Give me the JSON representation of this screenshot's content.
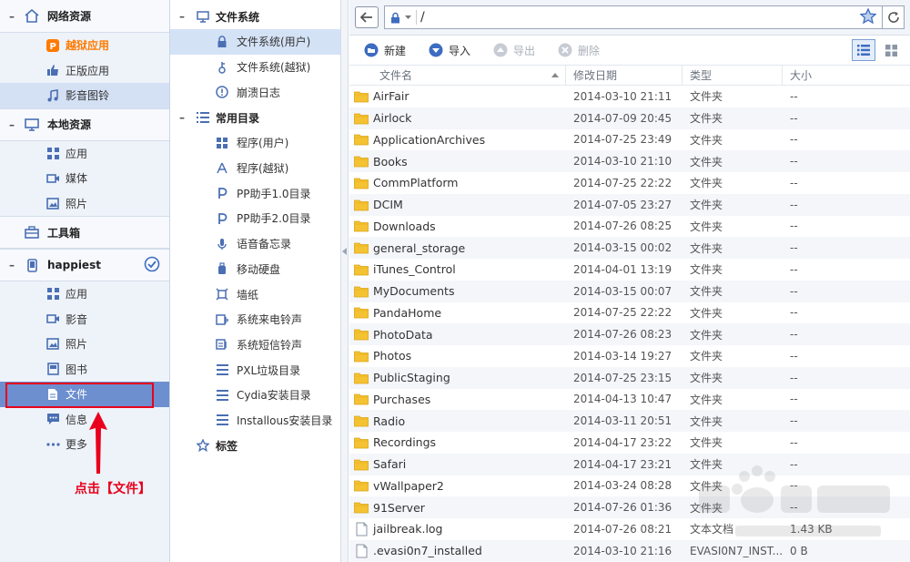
{
  "left": {
    "sections": [
      {
        "id": "network",
        "title": "网络资源",
        "items": [
          "越狱应用",
          "正版应用",
          "影音图铃"
        ]
      },
      {
        "id": "local",
        "title": "本地资源",
        "items": [
          "应用",
          "媒体",
          "照片"
        ]
      },
      {
        "id": "tools",
        "title": "工具箱"
      },
      {
        "id": "device",
        "title": "happiest",
        "items": [
          "应用",
          "影音",
          "照片",
          "图书",
          "文件",
          "信息",
          "更多"
        ]
      }
    ],
    "annotation": "点击【文件】"
  },
  "tree": {
    "fs_title": "文件系统",
    "fs_items": [
      "文件系统(用户)",
      "文件系统(越狱)",
      "崩溃日志"
    ],
    "common_title": "常用目录",
    "common_items": [
      "程序(用户)",
      "程序(越狱)",
      "PP助手1.0目录",
      "PP助手2.0目录",
      "语音备忘录",
      "移动硬盘",
      "墙纸",
      "系统来电铃声",
      "系统短信铃声",
      "PXL垃圾目录",
      "Cydia安装目录",
      "Installous安装目录"
    ],
    "tags_title": "标签"
  },
  "address": {
    "path": "/"
  },
  "toolbar": {
    "new": "新建",
    "import": "导入",
    "export": "导出",
    "delete": "删除"
  },
  "columns": {
    "name": "文件名",
    "date": "修改日期",
    "type": "类型",
    "size": "大小"
  },
  "files": [
    {
      "name": "AirFair",
      "date": "2014-03-10 21:11",
      "type": "文件夹",
      "size": "--",
      "kind": "folder"
    },
    {
      "name": "Airlock",
      "date": "2014-07-09 20:45",
      "type": "文件夹",
      "size": "--",
      "kind": "folder"
    },
    {
      "name": "ApplicationArchives",
      "date": "2014-07-25 23:49",
      "type": "文件夹",
      "size": "--",
      "kind": "folder"
    },
    {
      "name": "Books",
      "date": "2014-03-10 21:10",
      "type": "文件夹",
      "size": "--",
      "kind": "folder"
    },
    {
      "name": "CommPlatform",
      "date": "2014-07-25 22:22",
      "type": "文件夹",
      "size": "--",
      "kind": "folder"
    },
    {
      "name": "DCIM",
      "date": "2014-07-05 23:27",
      "type": "文件夹",
      "size": "--",
      "kind": "folder"
    },
    {
      "name": "Downloads",
      "date": "2014-07-26 08:25",
      "type": "文件夹",
      "size": "--",
      "kind": "folder"
    },
    {
      "name": "general_storage",
      "date": "2014-03-15 00:02",
      "type": "文件夹",
      "size": "--",
      "kind": "folder"
    },
    {
      "name": "iTunes_Control",
      "date": "2014-04-01 13:19",
      "type": "文件夹",
      "size": "--",
      "kind": "folder"
    },
    {
      "name": "MyDocuments",
      "date": "2014-03-15 00:07",
      "type": "文件夹",
      "size": "--",
      "kind": "folder"
    },
    {
      "name": "PandaHome",
      "date": "2014-07-25 22:22",
      "type": "文件夹",
      "size": "--",
      "kind": "folder"
    },
    {
      "name": "PhotoData",
      "date": "2014-07-26 08:23",
      "type": "文件夹",
      "size": "--",
      "kind": "folder"
    },
    {
      "name": "Photos",
      "date": "2014-03-14 19:27",
      "type": "文件夹",
      "size": "--",
      "kind": "folder"
    },
    {
      "name": "PublicStaging",
      "date": "2014-07-25 23:15",
      "type": "文件夹",
      "size": "--",
      "kind": "folder"
    },
    {
      "name": "Purchases",
      "date": "2014-04-13 10:47",
      "type": "文件夹",
      "size": "--",
      "kind": "folder"
    },
    {
      "name": "Radio",
      "date": "2014-03-11 20:51",
      "type": "文件夹",
      "size": "--",
      "kind": "folder"
    },
    {
      "name": "Recordings",
      "date": "2014-04-17 23:22",
      "type": "文件夹",
      "size": "--",
      "kind": "folder"
    },
    {
      "name": "Safari",
      "date": "2014-04-17 23:21",
      "type": "文件夹",
      "size": "--",
      "kind": "folder"
    },
    {
      "name": "vWallpaper2",
      "date": "2014-03-24 08:28",
      "type": "文件夹",
      "size": "--",
      "kind": "folder"
    },
    {
      "name": "91Server",
      "date": "2014-07-26 01:36",
      "type": "文件夹",
      "size": "--",
      "kind": "folder"
    },
    {
      "name": "jailbreak.log",
      "date": "2014-07-26 08:21",
      "type": "文本文档",
      "size": "1.43 KB",
      "kind": "file"
    },
    {
      "name": ".evasi0n7_installed",
      "date": "2014-03-10 21:16",
      "type": "EVASI0N7_INST...",
      "size": "0 B",
      "kind": "file"
    }
  ],
  "colors": {
    "accent": "#3d6cc0",
    "highlight": "#6d8fcf",
    "annotation": "#e8001c",
    "folder": "#f5c233",
    "orange": "#ff7a00"
  }
}
